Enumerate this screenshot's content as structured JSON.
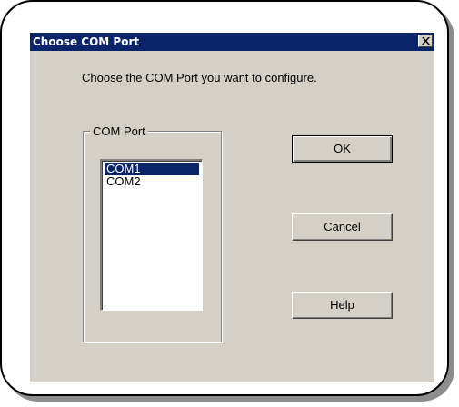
{
  "window": {
    "title": "Choose COM Port"
  },
  "instruction": "Choose the COM Port you want to configure.",
  "port_group": {
    "label": "COM Port",
    "options": [
      "COM1",
      "COM2"
    ],
    "selected": "COM1"
  },
  "buttons": {
    "ok": "OK",
    "cancel": "Cancel",
    "help": "Help"
  },
  "colors": {
    "title_bar": "#0a246a",
    "dialog_face": "#d4d0c8",
    "selection": "#0a246a"
  },
  "icons": {
    "close": "close-icon"
  }
}
